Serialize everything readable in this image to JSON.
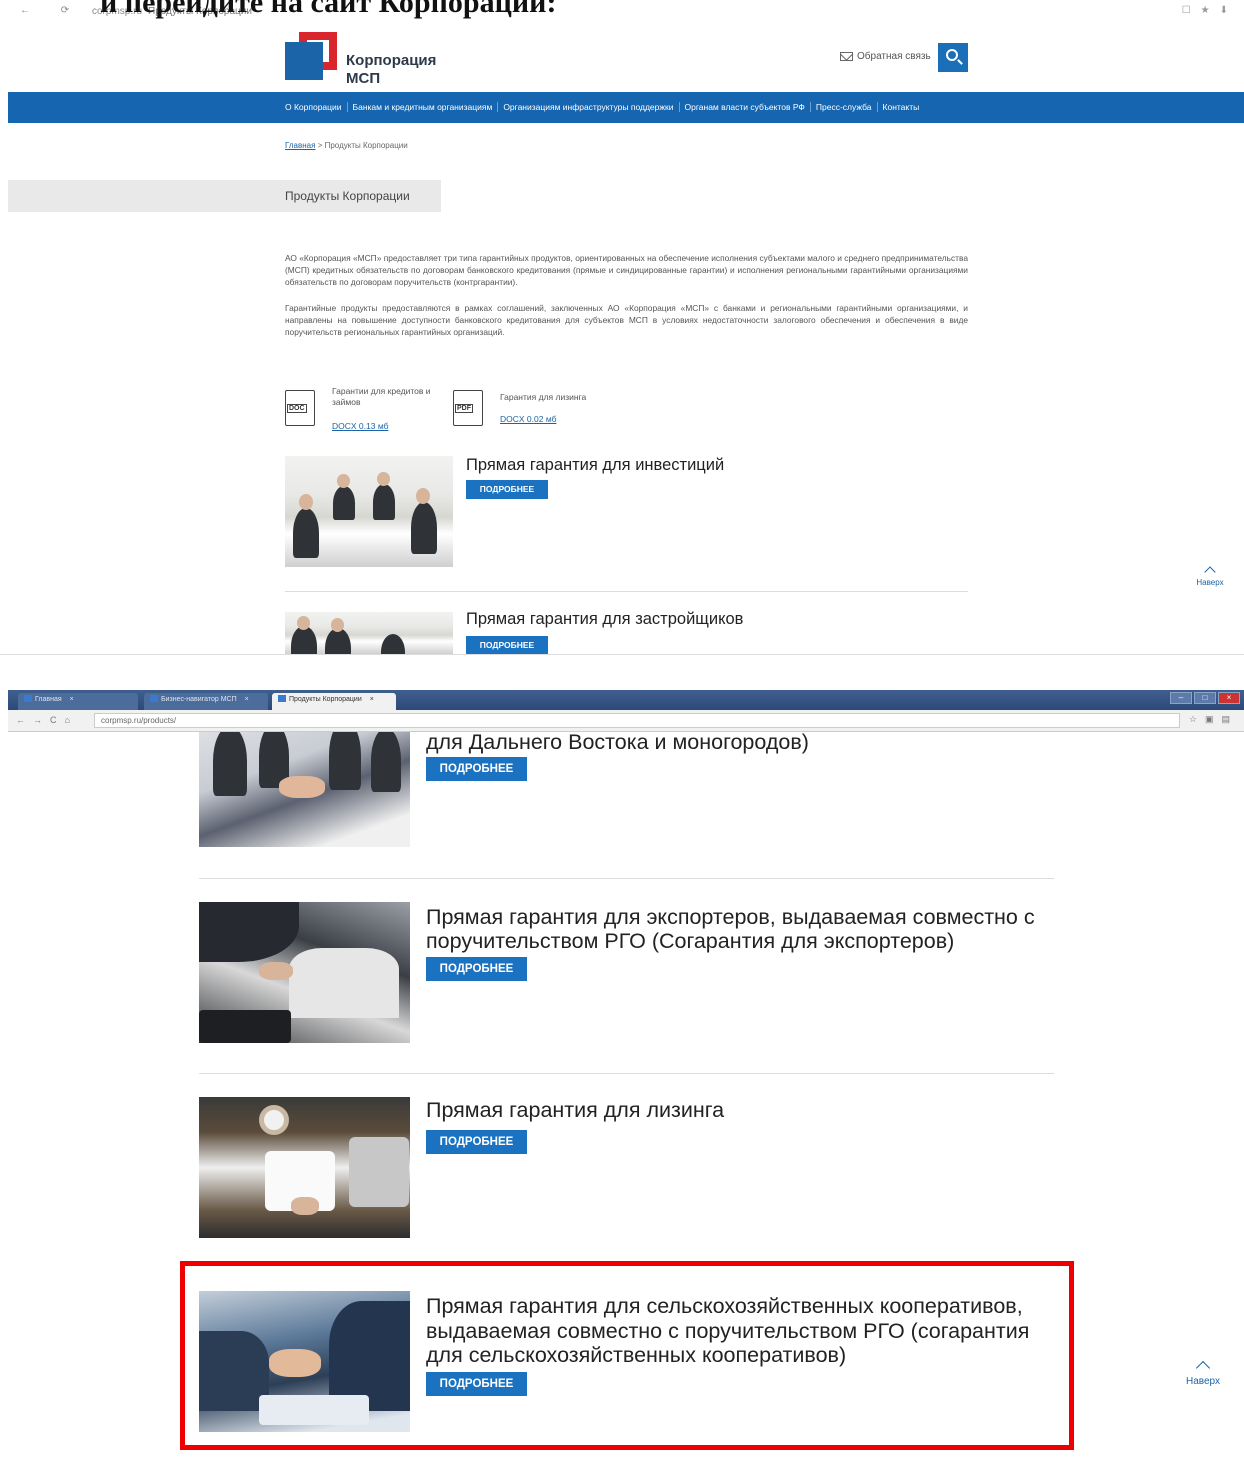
{
  "top_heading": "и перейдите на сайт Корпорации:",
  "browser1": {
    "host": "corpmsp.ru",
    "url_title": "Продукты Корпорации"
  },
  "header": {
    "logo_line1": "Корпорация",
    "logo_line2": "МСП",
    "feedback_label": "Обратная связь"
  },
  "nav": {
    "items": [
      "О Корпорации",
      "Банкам и кредитным организациям",
      "Организациям инфраструктуры поддержки",
      "Органам власти субъектов РФ",
      "Пресс-служба",
      "Контакты"
    ]
  },
  "breadcrumb": {
    "home": "Главная",
    "separator": ">",
    "current": "Продукты Корпорации"
  },
  "page_title": "Продукты Корпорации",
  "paragraphs": [
    "АО «Корпорация «МСП» предоставляет три типа гарантийных продуктов, ориентированных на обеспечение исполнения субъектами малого и среднего предпринимательства (МСП) кредитных обязательств по договорам банковского кредитования (прямые и синдицированные гарантии) и исполнения региональными гарантийными организациями обязательств по договорам поручительств (контргарантии).",
    "Гарантийные продукты предоставляются в рамках соглашений, заключенных АО «Корпорация «МСП» с банками и региональными гарантийными организациями, и направлены на повышение доступности банковского кредитования для субъектов МСП в условиях недостаточности залогового обеспечения и обеспечения в виде поручительств региональных гарантийных организаций."
  ],
  "files": [
    {
      "badge": "DOC",
      "name": "Гарантии для кредитов и займов",
      "link": "DOCX 0.13 мб"
    },
    {
      "badge": "PDF",
      "name": "Гарантия для лизинга",
      "link": "DOCX 0.02 мб"
    }
  ],
  "button_label": "ПОДРОБНЕЕ",
  "scroll_top_label": "Наверх",
  "products_top": [
    "Прямая гарантия для инвестиций",
    "Прямая гарантия для застройщиков"
  ],
  "browser2": {
    "tabs": [
      "Главная",
      "Бизнес-навигатор МСП",
      "Продукты Корпорации"
    ],
    "url": "corpmsp.ru/products/"
  },
  "products_bottom": [
    {
      "title": "выдаваемая совместно с поручительством РГО (Согарантия для Дальнего Востока и моногородов)"
    },
    {
      "title": "Прямая гарантия для экспортеров, выдаваемая совместно с поручительством РГО (Согарантия для экспортеров)"
    },
    {
      "title": "Прямая гарантия для лизинга"
    },
    {
      "title": "Прямая гарантия для сельскохозяйственных кооперативов, выдаваемая совместно с поручительством РГО (согарантия для сельскохозяйственных кооперативов)"
    }
  ],
  "highlight_color": "#ee0000",
  "accent_color": "#1565b0"
}
